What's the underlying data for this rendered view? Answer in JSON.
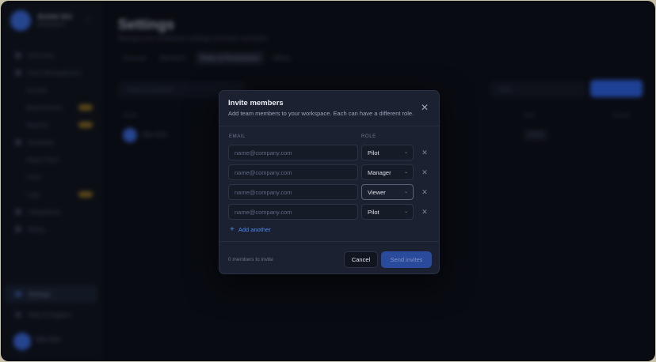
{
  "background": {
    "workspace": {
      "name": "Acme Inc",
      "subtitle": "Workspace"
    },
    "nav_items": [
      "Overview",
      "Fleet Management",
      "Aircraft",
      "Maintenance",
      "Reports",
      "Schedule",
      "Flight Plans",
      "Crew",
      "Logs",
      "Integrations",
      "Billing"
    ],
    "nav_bottom": {
      "active": "Settings",
      "other": "Help & Support"
    },
    "user_name": "Alex Kim",
    "page_title": "Settings",
    "page_subtitle": "Manage your workspace settings and team members.",
    "tabs": [
      "General",
      "Members",
      "Roles & Permissions",
      "Billing"
    ],
    "active_tab": "Roles & Permissions",
    "search_placeholder": "Search members",
    "filter_label": "Filter",
    "columns": [
      "Name",
      "Role",
      "Actions"
    ],
    "member_name": "Alex Kim",
    "member_role": "Admin"
  },
  "modal": {
    "title": "Invite members",
    "description": "Add team members to your workspace. Each can have a different role.",
    "email_label": "EMAIL",
    "role_label": "ROLE",
    "email_placeholder": "name@company.com",
    "rows": [
      {
        "email": "",
        "role": "Pilot"
      },
      {
        "email": "",
        "role": "Manager"
      },
      {
        "email": "",
        "role": "Viewer",
        "focused": true
      },
      {
        "email": "",
        "role": "Pilot"
      }
    ],
    "add_another_label": "Add another",
    "footer_note": "0 members to invite",
    "cancel_label": "Cancel",
    "send_label": "Send invites"
  },
  "icons": {
    "close": "close-icon",
    "chevron": "chevron-down-icon",
    "remove": "remove-icon",
    "add": "plus-icon"
  },
  "colors": {
    "accent": "#4d8af0",
    "primary_disabled": "#2a4a9c",
    "modal_bg": "#1b2131",
    "page_bg": "#0d0f17"
  }
}
